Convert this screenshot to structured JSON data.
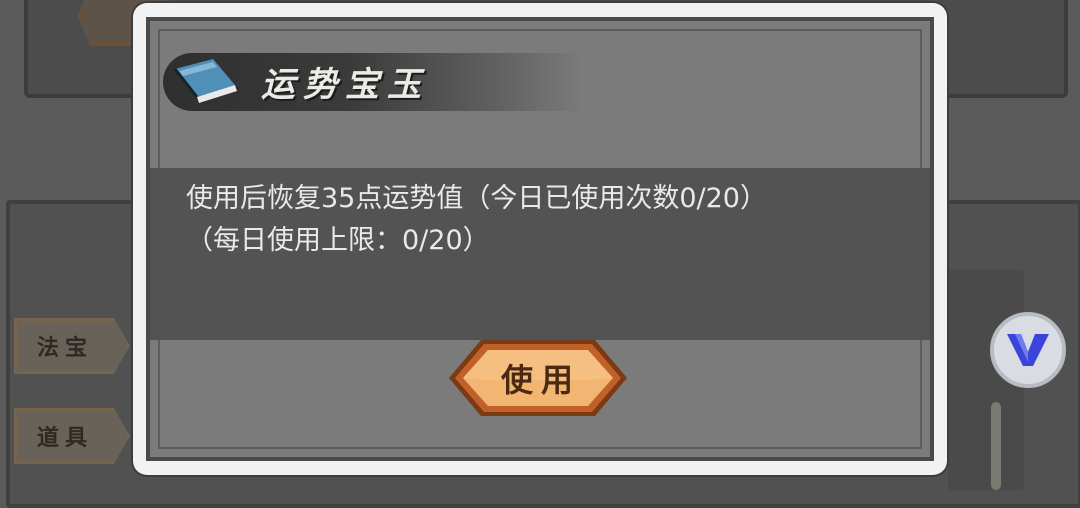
{
  "background": {
    "side_tabs": [
      {
        "label": "法宝"
      },
      {
        "label": "道具"
      }
    ]
  },
  "dialog": {
    "title": "运势宝玉",
    "title_icon": "book-icon",
    "description": "使用后恢复35点运势值（今日已使用次数0/20）（每日使用上限：0/20）",
    "use_button_label": "使用"
  },
  "floating_button": {
    "icon": "v-logo-icon"
  },
  "colors": {
    "dialog_frame": "#f2f2f2",
    "dialog_body": "#7b7b7b",
    "description_band": "#535353",
    "button_fill": "#f3b572",
    "button_border": "#b5531f",
    "logo_blue": "#3b44d8"
  }
}
